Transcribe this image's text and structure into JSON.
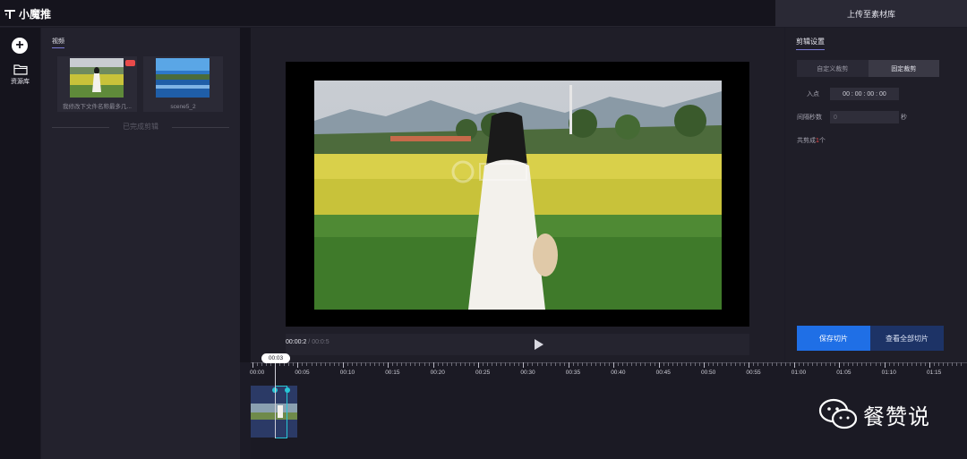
{
  "app": {
    "name": "小魔推",
    "upload_label": "上传至素材库"
  },
  "rail": {
    "library_label": "资源库"
  },
  "media": {
    "tab_label": "视频",
    "items": [
      {
        "caption": "我修改下文件名称最多几..."
      },
      {
        "caption": "scene5_2"
      }
    ],
    "done_label": "已完成剪辑"
  },
  "player": {
    "current_time": "00:00:2",
    "separator": " / ",
    "total_time": "00:0:5"
  },
  "settings": {
    "title": "剪辑设置",
    "tabs": [
      {
        "label": "自定义裁剪",
        "active": false
      },
      {
        "label": "固定裁剪",
        "active": true
      }
    ],
    "inpoint_label": "入点",
    "inpoint_value": "00 : 00 : 00 : 00",
    "interval_label": "间隔秒数",
    "interval_placeholder": "0",
    "interval_unit": "秒",
    "total_prefix": "共剪成",
    "total_count": "1",
    "total_suffix": "个",
    "save_label": "保存切片",
    "view_all_label": "查看全部切片"
  },
  "timeline": {
    "playhead_label": "00:03",
    "ticks": [
      "00:00",
      "00:05",
      "00:10",
      "00:15",
      "00:20",
      "00:25",
      "00:30",
      "00:35",
      "00:40",
      "00:45",
      "00:50",
      "00:55",
      "01:00",
      "01:05",
      "01:10",
      "01:15"
    ]
  },
  "stamp": {
    "text": "餐赞说"
  },
  "colors": {
    "accent": "#1f6fe6",
    "selection": "#27c6d6",
    "badge": "#e84a4a"
  }
}
